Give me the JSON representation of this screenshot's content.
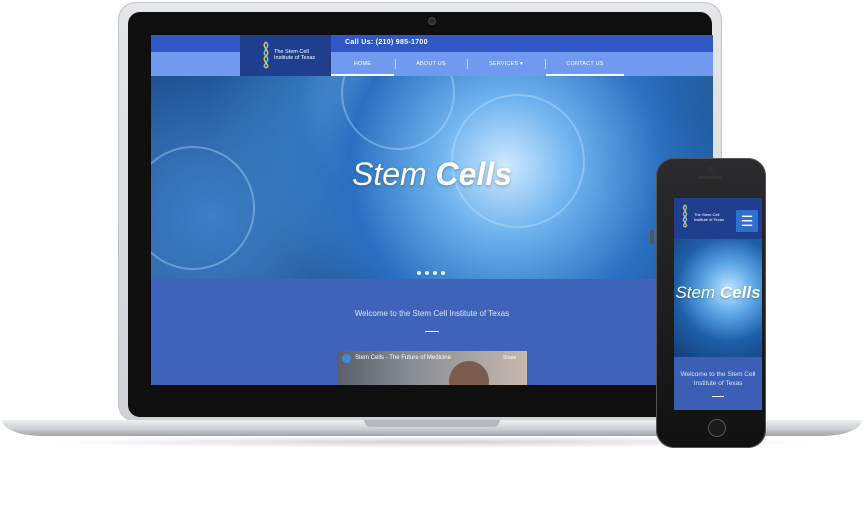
{
  "site": {
    "call_text": "Call Us: (210) 985-1700",
    "logo_line1": "The Stem Cell",
    "logo_line2": "Institute of Texas",
    "nav": {
      "home": "HOME",
      "about": "ABOUT US",
      "services": "SERVICES ▾",
      "contact": "CONTACT US"
    },
    "hero": {
      "title_light": "Stem",
      "title_bold": "Cells"
    },
    "welcome": "Welcome to the Stem Cell Institute of Texas",
    "video": {
      "title": "Stem Cells - The Future of Medicine",
      "share": "Share"
    }
  },
  "phone": {
    "logo_line1": "The Stem Cell",
    "logo_line2": "Institute of Texas",
    "menu_icon": "hamburger-icon",
    "hero": {
      "title_light": "Stem",
      "title_bold": "Cells"
    },
    "welcome": "Welcome to the Stem Cell Institute of Texas"
  },
  "colors": {
    "nav_blue": "#6f9af0",
    "dark_blue": "#1f3f8e",
    "section_blue": "#3e63b9"
  },
  "slider": {
    "dot_count": 4
  }
}
